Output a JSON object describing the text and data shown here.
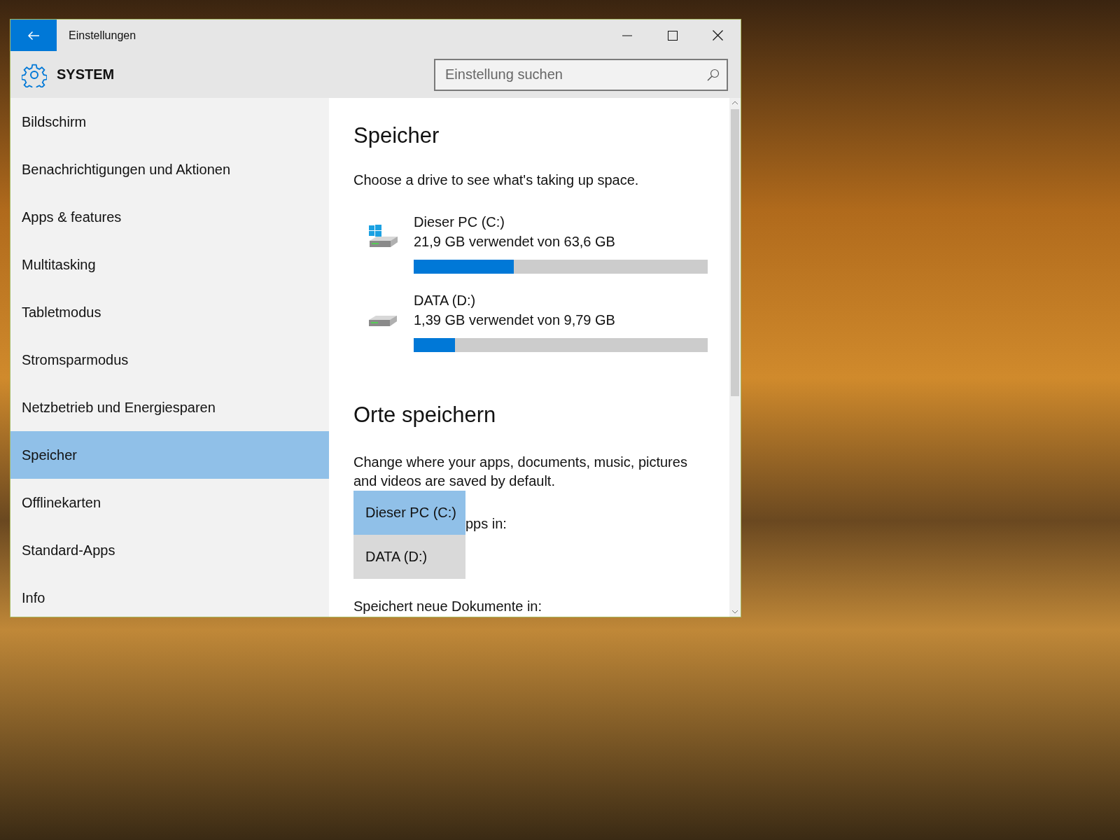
{
  "window": {
    "title": "Einstellungen"
  },
  "header": {
    "title": "SYSTEM",
    "search": {
      "placeholder": "Einstellung suchen"
    }
  },
  "sidebar": {
    "items": [
      {
        "label": "Bildschirm",
        "selected": false
      },
      {
        "label": "Benachrichtigungen und Aktionen",
        "selected": false
      },
      {
        "label": "Apps & features",
        "selected": false
      },
      {
        "label": "Multitasking",
        "selected": false
      },
      {
        "label": "Tabletmodus",
        "selected": false
      },
      {
        "label": "Stromsparmodus",
        "selected": false
      },
      {
        "label": "Netzbetrieb und Energiesparen",
        "selected": false
      },
      {
        "label": "Speicher",
        "selected": true
      },
      {
        "label": "Offlinekarten",
        "selected": false
      },
      {
        "label": "Standard-Apps",
        "selected": false
      },
      {
        "label": "Info",
        "selected": false
      }
    ]
  },
  "content": {
    "title": "Speicher",
    "subtitle": "Choose a drive to see what's taking up space.",
    "drives": [
      {
        "name": "Dieser PC (C:)",
        "usage": "21,9 GB verwendet von 63,6 GB",
        "level": 0.34,
        "kind": "system"
      },
      {
        "name": "DATA (D:)",
        "usage": "1,39 GB verwendet von 9,79 GB",
        "level": 0.14,
        "kind": "data"
      }
    ],
    "locations_title": "Orte speichern",
    "locations_text": "Change where your apps, documents, music, pictures and videos are saved by default.",
    "apps_dropdown": {
      "options": [
        {
          "label": "Dieser PC (C:)",
          "selected": true
        },
        {
          "label": "DATA (D:)",
          "selected": false
        }
      ],
      "label_visible": "pps in:"
    },
    "documents_label": "Speichert neue Dokumente in:"
  }
}
